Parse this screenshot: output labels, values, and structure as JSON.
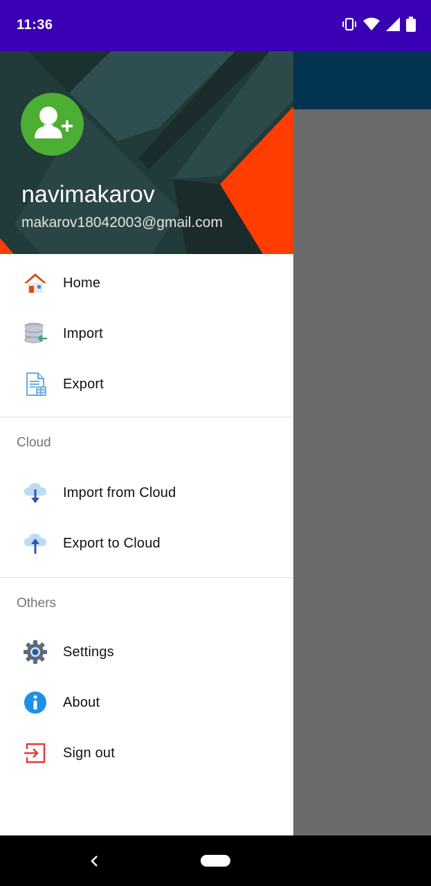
{
  "status_bar": {
    "time": "11:36",
    "icons": [
      "vibrate-icon",
      "wifi-icon",
      "signal-icon",
      "battery-icon"
    ]
  },
  "drawer": {
    "header": {
      "username": "navimakarov",
      "email": "makarov18042003@gmail.com",
      "avatar_icon": "add-user-icon",
      "colors": {
        "background": "#213a3a",
        "accent": "#ff3d00",
        "avatar": "#4cae32"
      }
    },
    "menu": [
      {
        "label": "Home",
        "icon": "home-icon"
      },
      {
        "label": "Import",
        "icon": "database-import-icon"
      },
      {
        "label": "Export",
        "icon": "document-export-icon"
      }
    ],
    "sections": [
      {
        "title": "Cloud",
        "items": [
          {
            "label": "Import from Cloud",
            "icon": "cloud-download-icon"
          },
          {
            "label": "Export to Cloud",
            "icon": "cloud-upload-icon"
          }
        ]
      },
      {
        "title": "Others",
        "items": [
          {
            "label": "Settings",
            "icon": "gear-icon"
          },
          {
            "label": "About",
            "icon": "info-icon"
          },
          {
            "label": "Sign out",
            "icon": "sign-out-icon"
          }
        ]
      }
    ]
  },
  "colors": {
    "status_bar": "#3a00b4",
    "app_bar": "#023350",
    "scrim": "#6b6b6b",
    "nav_bar": "#000000"
  }
}
